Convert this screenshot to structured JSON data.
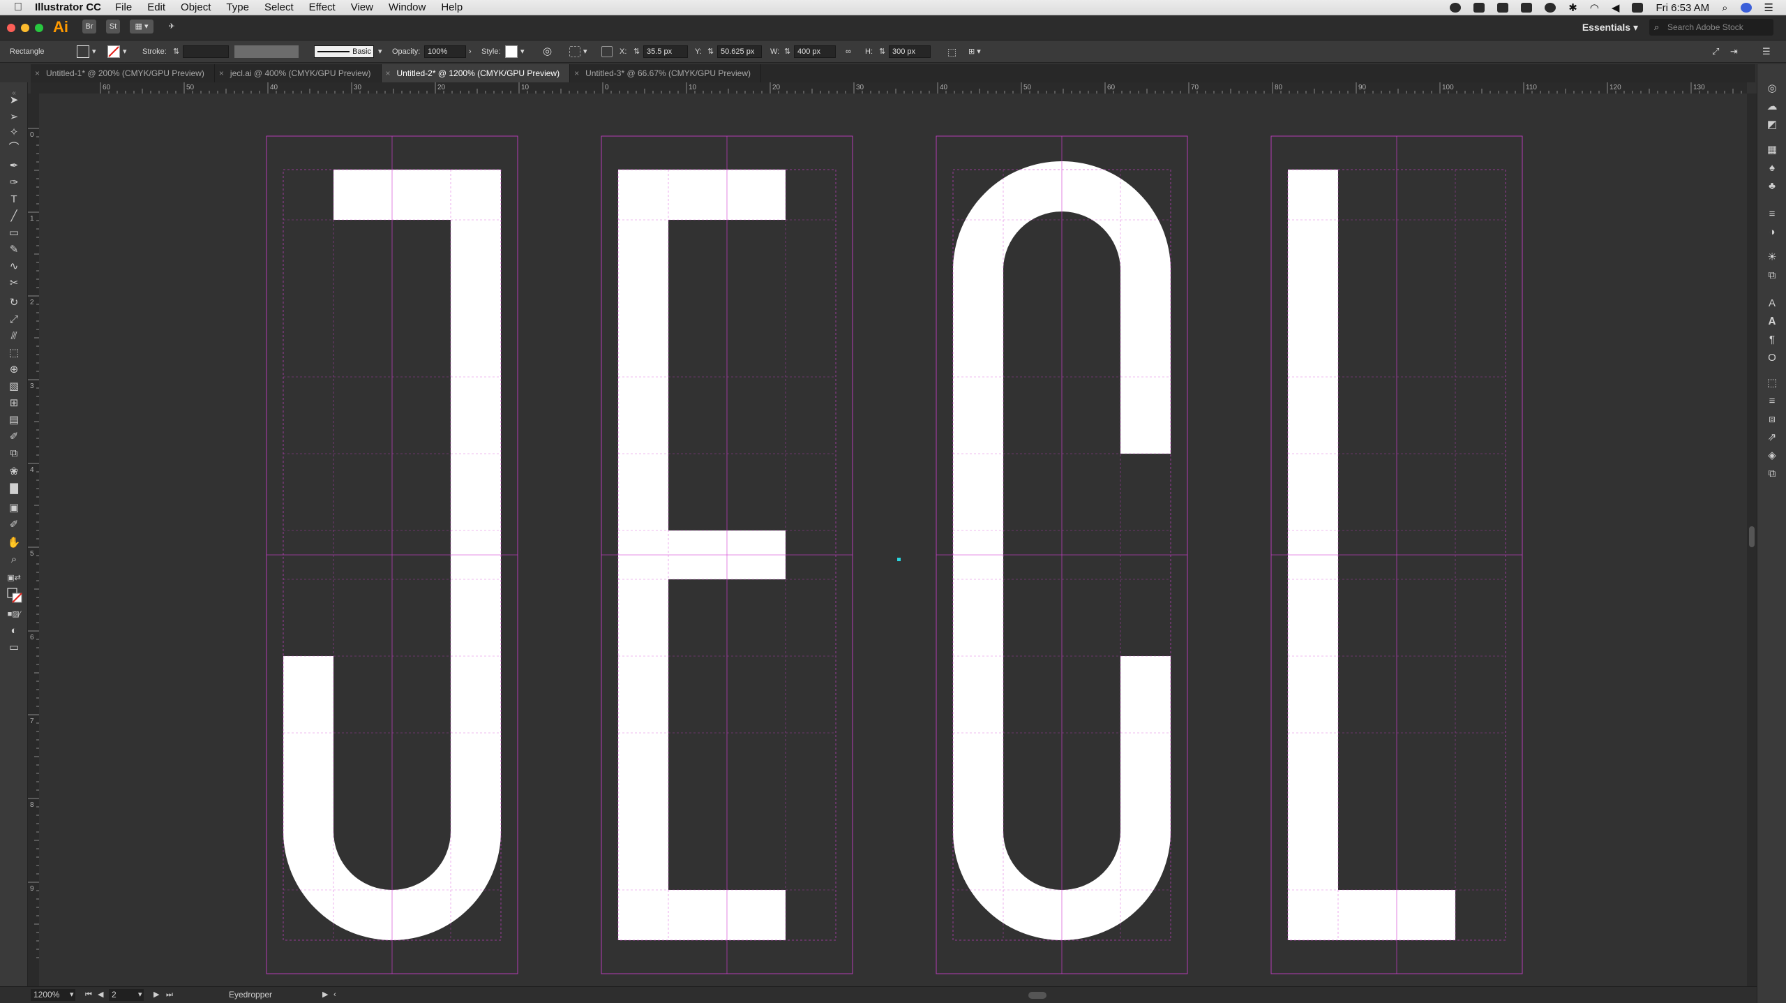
{
  "menubar": {
    "app_name": "Illustrator CC",
    "items": [
      "File",
      "Edit",
      "Object",
      "Type",
      "Select",
      "Effect",
      "View",
      "Window",
      "Help"
    ],
    "clock": "Fri 6:53 AM"
  },
  "appbar": {
    "logo": "Ai",
    "br": "Br",
    "st": "St",
    "workspace": "Essentials",
    "search_placeholder": "Search Adobe Stock"
  },
  "control": {
    "selection": "Rectangle",
    "stroke_label": "Stroke:",
    "brush": "Basic",
    "opacity_label": "Opacity:",
    "opacity_value": "100%",
    "style_label": "Style:",
    "x_label": "X:",
    "x_value": "35.5 px",
    "y_label": "Y:",
    "y_value": "50.625 px",
    "w_label": "W:",
    "w_value": "400 px",
    "h_label": "H:",
    "h_value": "300 px"
  },
  "tabs": [
    {
      "label": "Untitled-1* @ 200% (CMYK/GPU Preview)",
      "active": false
    },
    {
      "label": "jecl.ai @ 400% (CMYK/GPU Preview)",
      "active": false
    },
    {
      "label": "Untitled-2* @ 1200% (CMYK/GPU Preview)",
      "active": true
    },
    {
      "label": "Untitled-3* @ 66.67% (CMYK/GPU Preview)",
      "active": false
    }
  ],
  "ruler_h_labels": [
    "60",
    "50",
    "40",
    "30",
    "20",
    "10",
    "0",
    "10",
    "20",
    "30",
    "40",
    "50",
    "60",
    "70",
    "80",
    "90",
    "100",
    "110",
    "120",
    "130"
  ],
  "ruler_v_labels": [
    "0",
    "1",
    "2",
    "3",
    "4",
    "5",
    "6",
    "7",
    "8",
    "9"
  ],
  "status": {
    "zoom": "1200%",
    "page": "2",
    "tool": "Eyedropper"
  },
  "colors": {
    "guide": "#d43fd4",
    "glyph": "#ffffff",
    "canvas": "#323232",
    "accent_point": "#29d6e0"
  }
}
